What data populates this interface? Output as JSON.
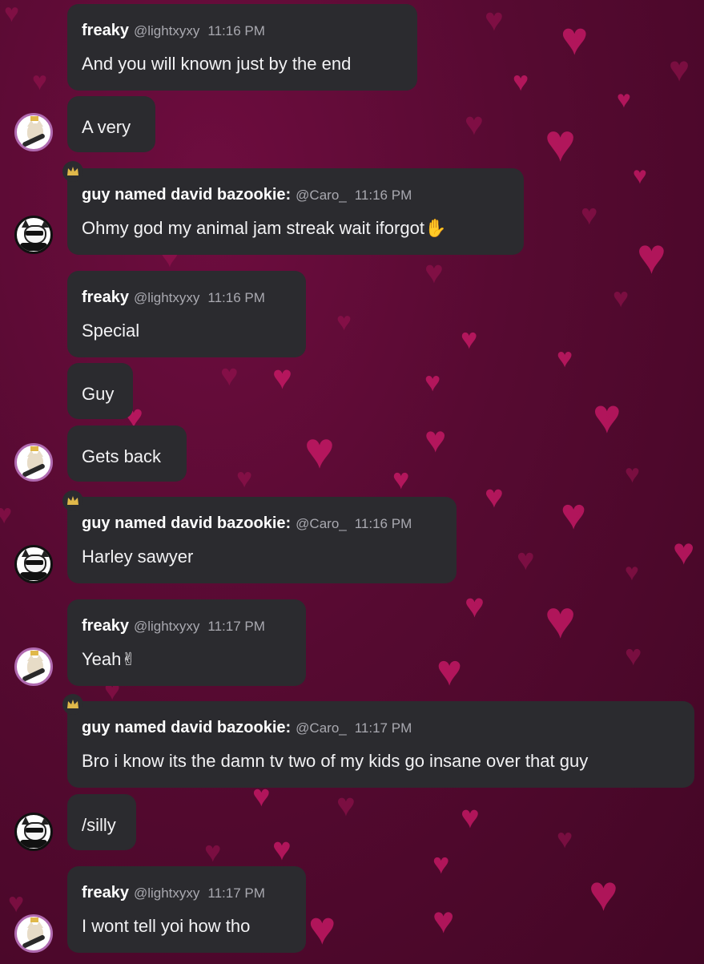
{
  "colors": {
    "background": "#560a31",
    "bubble": "#2b2b2f",
    "heart": "#d11a6a",
    "username": "#ffffff",
    "meta": "#a9a9b0",
    "text": "#f2f2f4",
    "crown": "#e0b84a"
  },
  "icons": {
    "raised_hand": "✋",
    "victory_hand": "✌"
  },
  "messages": [
    {
      "username": "freaky",
      "handle": "@lightxyxy",
      "time": "11:16 PM",
      "text": "And you will known just by the end"
    },
    {
      "text": "A very"
    },
    {
      "username": "guy named david bazookie:",
      "handle": "@Caro_",
      "time": "11:16 PM",
      "text": "Ohmy god my animal jam streak wait iforgot"
    },
    {
      "username": "freaky",
      "handle": "@lightxyxy",
      "time": "11:16 PM",
      "text": "Special"
    },
    {
      "text": "Guy"
    },
    {
      "text": "Gets back"
    },
    {
      "username": "guy named david bazookie:",
      "handle": "@Caro_",
      "time": "11:16 PM",
      "text": "Harley sawyer"
    },
    {
      "username": "freaky",
      "handle": "@lightxyxy",
      "time": "11:17 PM",
      "text": "Yeah"
    },
    {
      "username": "guy named david bazookie:",
      "handle": "@Caro_",
      "time": "11:17 PM",
      "text": "Bro i know its the damn tv two of my kids go insane over that guy"
    },
    {
      "text": "/silly"
    },
    {
      "username": "freaky",
      "handle": "@lightxyxy",
      "time": "11:17 PM",
      "text": "I wont tell yoi how tho"
    }
  ]
}
